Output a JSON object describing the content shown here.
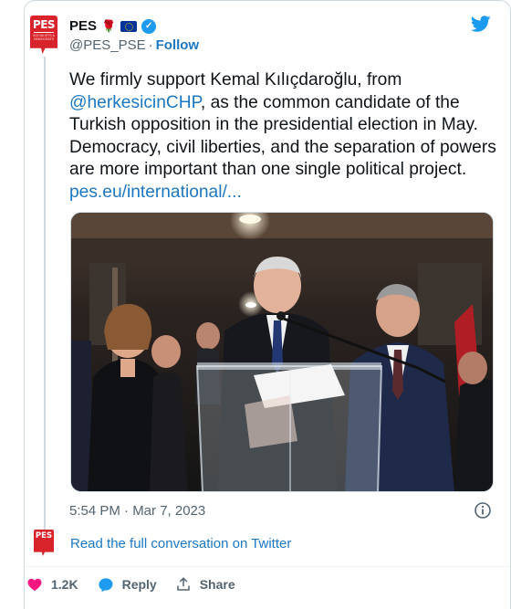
{
  "author": {
    "name": "PES",
    "handle": "@PES_PSE",
    "follow_label": "Follow",
    "avatar_text": "PES",
    "avatar_subtext": "SOCIALISTS & DEMOCRATS",
    "emoji": [
      "rose-icon",
      "eu-flag-icon"
    ],
    "verified": true
  },
  "tweet": {
    "text_part1": "We firmly support Kemal Kılıçdaroğlu, from ",
    "mention": "@herkesicinCHP",
    "text_part2": ", as the common candidate of the Turkish opposition in the presidential election in May. Democracy, civil liberties, and the separation of powers are more important than one single political project. ",
    "link": "pes.eu/international/...",
    "image_description_icon": "press-conference-photo"
  },
  "timestamp": "5:54 PM · Mar 7, 2023",
  "read_full_label": "Read the full conversation on Twitter",
  "actions": {
    "like_count": "1.2K",
    "reply_label": "Reply",
    "share_label": "Share"
  },
  "colors": {
    "brand_red": "#d8232a",
    "link_blue": "#1d77c2",
    "twitter_blue": "#1d9bf0",
    "like_red": "#f91880",
    "muted_text": "#536471"
  }
}
